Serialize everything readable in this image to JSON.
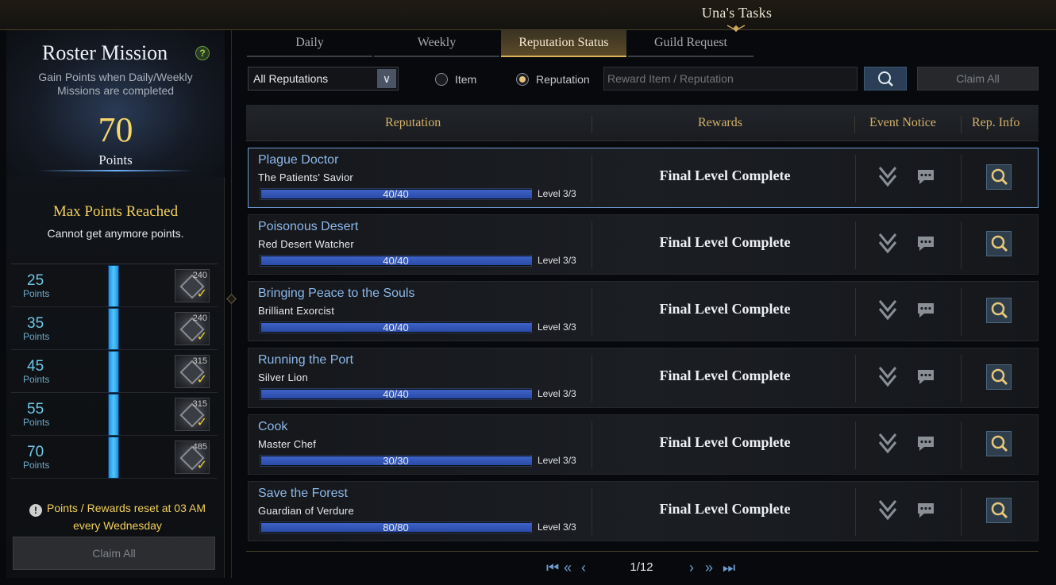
{
  "window": {
    "title": "Una's Tasks"
  },
  "left_panel": {
    "title": "Roster Mission",
    "help": "?",
    "description": "Gain Points when Daily/Weekly Missions are completed",
    "points_value": "70",
    "points_label": "Points",
    "max_title": "Max Points Reached",
    "max_subtitle": "Cannot get anymore points.",
    "tiers": [
      {
        "points": "25",
        "unit": "Points",
        "reward_count": "240",
        "claimed": "✓"
      },
      {
        "points": "35",
        "unit": "Points",
        "reward_count": "240",
        "claimed": "✓"
      },
      {
        "points": "45",
        "unit": "Points",
        "reward_count": "315",
        "claimed": "✓"
      },
      {
        "points": "55",
        "unit": "Points",
        "reward_count": "315",
        "claimed": "✓"
      },
      {
        "points": "70",
        "unit": "Points",
        "reward_count": "485",
        "claimed": "✓"
      }
    ],
    "reset_note": "Points / Rewards reset at 03 AM every Wednesday",
    "claim_all": "Claim All"
  },
  "tabs": [
    {
      "label": "Daily"
    },
    {
      "label": "Weekly"
    },
    {
      "label": "Reputation Status",
      "active": true
    },
    {
      "label": "Guild Request"
    }
  ],
  "filters": {
    "dropdown_value": "All Reputations",
    "radio_item": "Item",
    "radio_reputation": "Reputation",
    "selected_radio": "Reputation",
    "search_placeholder": "Reward Item / Reputation",
    "claim_all": "Claim All"
  },
  "table": {
    "headers": {
      "reputation": "Reputation",
      "rewards": "Rewards",
      "event_notice": "Event Notice",
      "rep_info": "Rep. Info"
    },
    "rows": [
      {
        "name": "Plague Doctor",
        "title": "The Patients' Savior",
        "progress": "40/40",
        "progress_fraction": 1.0,
        "level": "Level 3/3",
        "reward": "Final Level Complete"
      },
      {
        "name": "Poisonous Desert",
        "title": "Red Desert Watcher",
        "progress": "40/40",
        "progress_fraction": 1.0,
        "level": "Level 3/3",
        "reward": "Final Level Complete"
      },
      {
        "name": "Bringing Peace to the Souls",
        "title": "Brilliant Exorcist",
        "progress": "40/40",
        "progress_fraction": 1.0,
        "level": "Level 3/3",
        "reward": "Final Level Complete"
      },
      {
        "name": "Running the Port",
        "title": "Silver Lion",
        "progress": "40/40",
        "progress_fraction": 1.0,
        "level": "Level 3/3",
        "reward": "Final Level Complete"
      },
      {
        "name": "Cook",
        "title": "Master Chef",
        "progress": "30/30",
        "progress_fraction": 1.0,
        "level": "Level 3/3",
        "reward": "Final Level Complete"
      },
      {
        "name": "Save the Forest",
        "title": "Guardian of Verdure",
        "progress": "80/80",
        "progress_fraction": 1.0,
        "level": "Level 3/3",
        "reward": "Final Level Complete"
      }
    ]
  },
  "pagination": {
    "page": "1/12"
  },
  "icons": {
    "help": "help-icon",
    "warning": "warning-icon",
    "dropdown": "chevron-down-icon",
    "search": "search-icon",
    "notice": "chevron-double-down-icon",
    "chat": "chat-bubble-icon",
    "rep_info": "magnifier-icon",
    "first": "first-page-icon",
    "prev_fast": "rewind-icon",
    "prev": "prev-page-icon",
    "next": "next-page-icon",
    "next_fast": "fast-forward-icon",
    "last": "last-page-icon"
  },
  "colors": {
    "accent_gold": "#d4b26a",
    "accent_blue": "#8db8ea",
    "progress_fill": "#2a4aa6",
    "selected_border": "#6f9bd0"
  }
}
